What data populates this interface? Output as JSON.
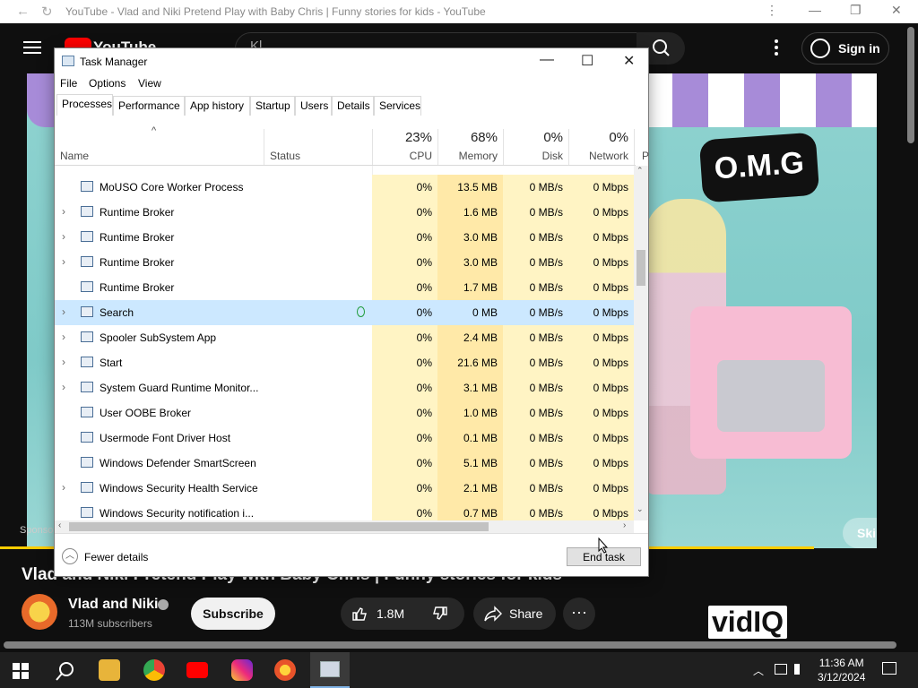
{
  "browser": {
    "title": "YouTube - Vlad and Niki Pretend Play with Baby Chris | Funny stories for kids - YouTube",
    "back_icon": "←",
    "reload_icon": "↻",
    "menu_icon": "⋮",
    "minimize_icon": "—",
    "restore_icon": "❐",
    "close_icon": "✕"
  },
  "youtube": {
    "logo_text": "YouTube",
    "search_value": "Kl",
    "signin_label": "Sign in",
    "skip_label": "Skip ▸|",
    "sponsored": "Sponsored",
    "video_title": "Vlad and Niki Pretend Play with Baby Chris | Funny stories for kids",
    "channel_name": "Vlad and Niki",
    "subscribers": "113M subscribers",
    "subscribe_label": "Subscribe",
    "likes": "1.8M",
    "share_label": "Share",
    "more_label": "···",
    "omg_text": "O.M.G",
    "vidiq_text": "vidIQ"
  },
  "taskbar": {
    "time": "11:36 AM",
    "date": "3/12/2024"
  },
  "task_manager": {
    "title": "Task Manager",
    "minimize": "—",
    "maximize": "☐",
    "close": "✕",
    "menu": [
      "File",
      "Options",
      "View"
    ],
    "tabs": [
      "Processes",
      "Performance",
      "App history",
      "Startup",
      "Users",
      "Details",
      "Services"
    ],
    "active_tab": "Processes",
    "sort_arrow": "^",
    "columns": {
      "name": "Name",
      "status": "Status",
      "cpu_pct": "23%",
      "cpu": "CPU",
      "mem_pct": "68%",
      "mem": "Memory",
      "disk_pct": "0%",
      "disk": "Disk",
      "net_pct": "0%",
      "net": "Network",
      "extra": "P"
    },
    "processes": [
      {
        "name": "MoUSO Core Worker Process",
        "expandable": false,
        "cpu": "0%",
        "mem": "13.5 MB",
        "disk": "0 MB/s",
        "net": "0 Mbps"
      },
      {
        "name": "Runtime Broker",
        "expandable": true,
        "cpu": "0%",
        "mem": "1.6 MB",
        "disk": "0 MB/s",
        "net": "0 Mbps"
      },
      {
        "name": "Runtime Broker",
        "expandable": true,
        "cpu": "0%",
        "mem": "3.0 MB",
        "disk": "0 MB/s",
        "net": "0 Mbps"
      },
      {
        "name": "Runtime Broker",
        "expandable": true,
        "cpu": "0%",
        "mem": "3.0 MB",
        "disk": "0 MB/s",
        "net": "0 Mbps"
      },
      {
        "name": "Runtime Broker",
        "expandable": false,
        "cpu": "0%",
        "mem": "1.7 MB",
        "disk": "0 MB/s",
        "net": "0 Mbps"
      },
      {
        "name": "Search",
        "expandable": true,
        "selected": true,
        "suspended": true,
        "cpu": "0%",
        "mem": "0 MB",
        "disk": "0 MB/s",
        "net": "0 Mbps"
      },
      {
        "name": "Spooler SubSystem App",
        "expandable": true,
        "cpu": "0%",
        "mem": "2.4 MB",
        "disk": "0 MB/s",
        "net": "0 Mbps"
      },
      {
        "name": "Start",
        "expandable": true,
        "cpu": "0%",
        "mem": "21.6 MB",
        "disk": "0 MB/s",
        "net": "0 Mbps"
      },
      {
        "name": "System Guard Runtime Monitor...",
        "expandable": true,
        "cpu": "0%",
        "mem": "3.1 MB",
        "disk": "0 MB/s",
        "net": "0 Mbps"
      },
      {
        "name": "User OOBE Broker",
        "expandable": false,
        "cpu": "0%",
        "mem": "1.0 MB",
        "disk": "0 MB/s",
        "net": "0 Mbps"
      },
      {
        "name": "Usermode Font Driver Host",
        "expandable": false,
        "cpu": "0%",
        "mem": "0.1 MB",
        "disk": "0 MB/s",
        "net": "0 Mbps"
      },
      {
        "name": "Windows Defender SmartScreen",
        "expandable": false,
        "cpu": "0%",
        "mem": "5.1 MB",
        "disk": "0 MB/s",
        "net": "0 Mbps"
      },
      {
        "name": "Windows Security Health Service",
        "expandable": true,
        "cpu": "0%",
        "mem": "2.1 MB",
        "disk": "0 MB/s",
        "net": "0 Mbps"
      },
      {
        "name": "Windows Security notification i...",
        "expandable": false,
        "cpu": "0%",
        "mem": "0.7 MB",
        "disk": "0 MB/s",
        "net": "0 Mbps"
      }
    ],
    "fewer_details": "Fewer details",
    "end_task": "End task"
  }
}
